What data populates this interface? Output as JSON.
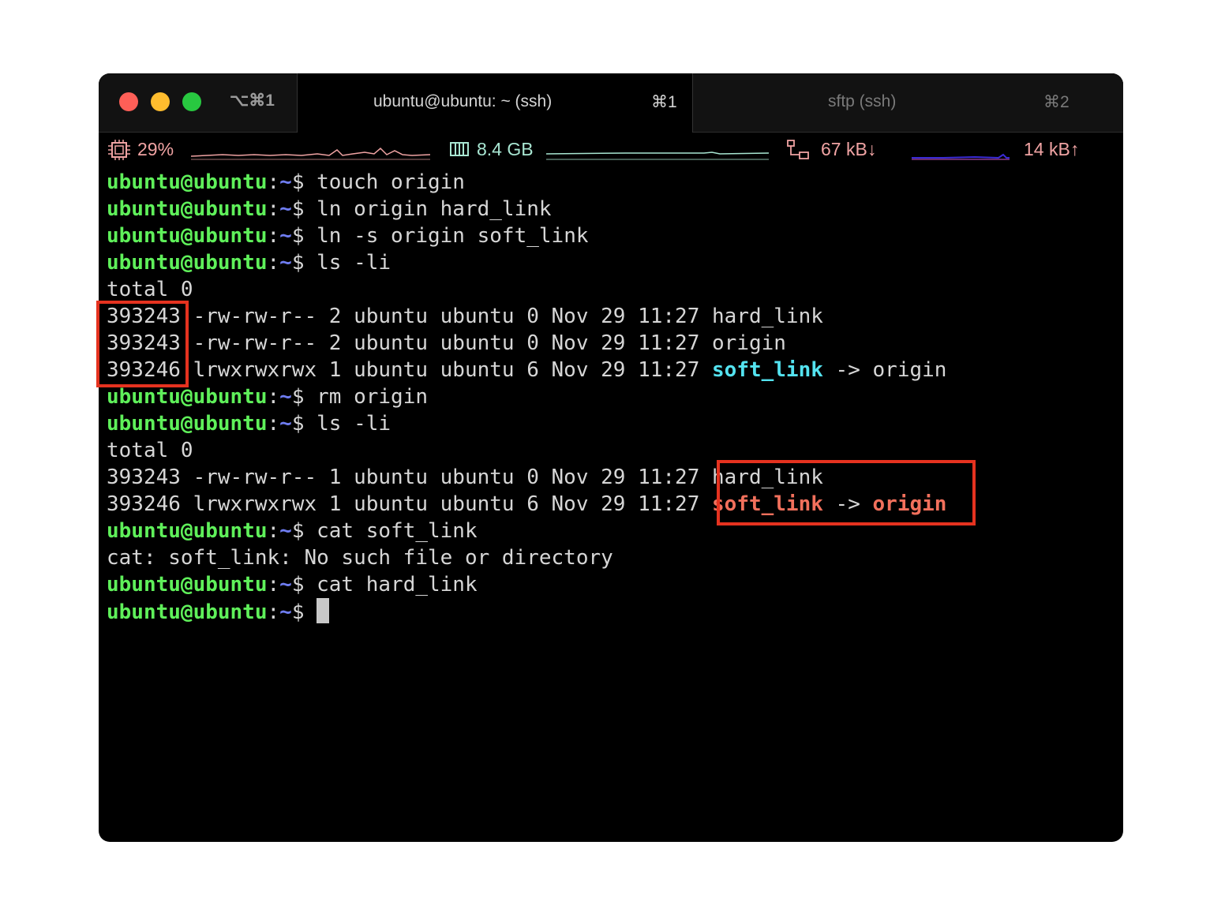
{
  "titlebar": {
    "window_shortcut": "⌥⌘1",
    "tabs": [
      {
        "title": "ubuntu@ubuntu: ~ (ssh)",
        "shortcut": "⌘1",
        "active": true
      },
      {
        "title": "sftp (ssh)",
        "shortcut": "⌘2",
        "active": false
      }
    ]
  },
  "status": {
    "cpu": "29%",
    "memory": "8.4 GB",
    "net_down": "67 kB↓",
    "net_up": "14 kB↑",
    "icons": [
      "cpu-icon",
      "memory-icon",
      "network-icon"
    ],
    "colors": {
      "cpu": "#f0a3a3",
      "memory": "#a8e6d2",
      "network": "#f0a3a3",
      "net_graph": "#3a2bd6"
    }
  },
  "prompt": {
    "user": "ubuntu@ubuntu",
    "colon": ":",
    "path": "~",
    "dollar": "$ "
  },
  "terminal": [
    {
      "type": "cmd",
      "text": "touch origin"
    },
    {
      "type": "cmd",
      "text": "ln origin hard_link"
    },
    {
      "type": "cmd",
      "text": "ln -s origin soft_link"
    },
    {
      "type": "cmd",
      "text": "ls -li"
    },
    {
      "type": "out",
      "text": "total 0"
    },
    {
      "type": "ls",
      "inode": "393243",
      "rest": " -rw-rw-r-- 2 ubuntu ubuntu 0 Nov 29 11:27 ",
      "name": "hard_link"
    },
    {
      "type": "ls",
      "inode": "393243",
      "rest": " -rw-rw-r-- 2 ubuntu ubuntu 0 Nov 29 11:27 ",
      "name": "origin"
    },
    {
      "type": "ls",
      "inode": "393246",
      "rest": " lrwxrwxrwx 1 ubuntu ubuntu 6 Nov 29 11:27 ",
      "name": "soft_link",
      "arrow": " -> ",
      "target": "origin",
      "style": "cyan"
    },
    {
      "type": "cmd",
      "text": "rm origin"
    },
    {
      "type": "cmd",
      "text": "ls -li"
    },
    {
      "type": "out",
      "text": "total 0"
    },
    {
      "type": "ls",
      "inode": "393243",
      "rest": " -rw-rw-r-- 1 ubuntu ubuntu 0 Nov 29 11:27 ",
      "name": "hard_link"
    },
    {
      "type": "ls",
      "inode": "393246",
      "rest": " lrwxrwxrwx 1 ubuntu ubuntu 6 Nov 29 11:27 ",
      "name": "soft_link",
      "arrow": " -> ",
      "target": "origin",
      "style": "red"
    },
    {
      "type": "cmd",
      "text": "cat soft_link"
    },
    {
      "type": "out",
      "text": "cat: soft_link: No such file or directory"
    },
    {
      "type": "cmd",
      "text": "cat hard_link"
    },
    {
      "type": "cursor"
    }
  ],
  "highlight_color": "#e5321f"
}
